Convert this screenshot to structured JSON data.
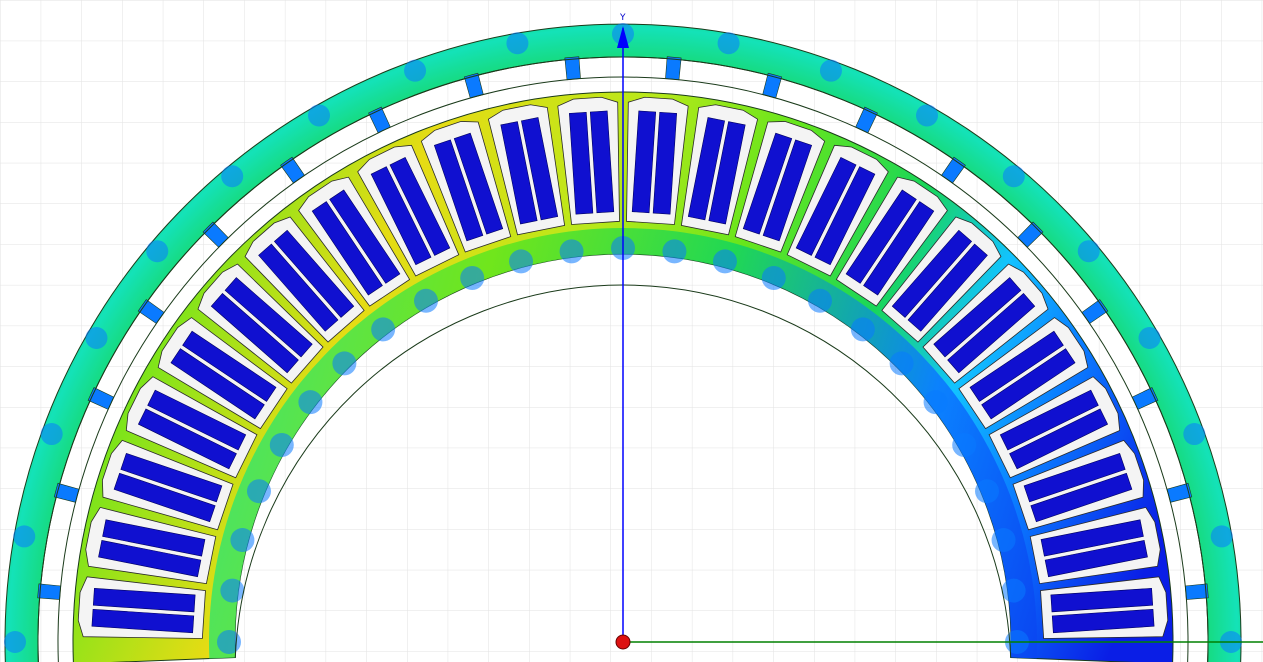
{
  "view": {
    "grid": true,
    "background": "#ffffff",
    "grid_color": "#e2e2e2",
    "y_axis_label": "Y",
    "x_axis_color": "#008000",
    "y_axis_color": "#0000ff",
    "origin_marker_color": "#dd1111"
  },
  "model": {
    "type": "stator-rotor-half-section",
    "slot_count_visible": 24,
    "conductor_color": "#1010d0",
    "slot_liner_color": "#f4f4f4",
    "field_palette": [
      "#0a1ee6",
      "#0a7aff",
      "#12c3ff",
      "#14e2b8",
      "#18d65a",
      "#66e61c",
      "#b8e81a",
      "#e6dc14"
    ]
  }
}
